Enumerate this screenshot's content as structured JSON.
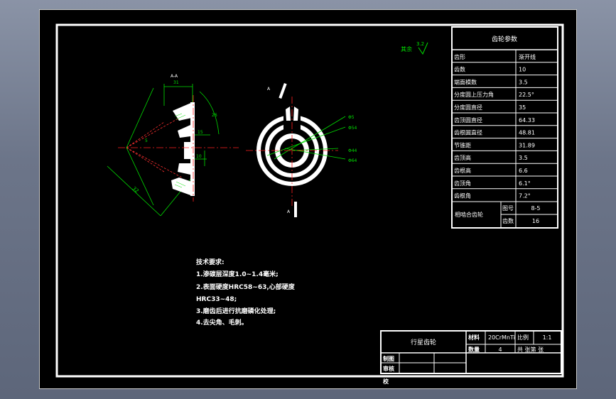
{
  "params_table": {
    "title": "齿轮参数",
    "rows": [
      {
        "label": "齿形",
        "value": "渐开线"
      },
      {
        "label": "齿数",
        "value": "10"
      },
      {
        "label": "端面模数",
        "value": "3.5"
      },
      {
        "label": "分度圆上压力角",
        "value": "22.5°"
      },
      {
        "label": "分度圆直径",
        "value": "35"
      },
      {
        "label": "齿顶圆直径",
        "value": "64.33"
      },
      {
        "label": "齿根圆直径",
        "value": "48.81"
      },
      {
        "label": "节锥距",
        "value": "31.89"
      },
      {
        "label": "齿顶高",
        "value": "3.5"
      },
      {
        "label": "齿根高",
        "value": "6.6"
      },
      {
        "label": "齿顶角",
        "value": "6.1°"
      },
      {
        "label": "齿根角",
        "value": "7.2°"
      }
    ],
    "mating": {
      "label": "相啮合齿轮",
      "sub1_label": "图号",
      "sub1_value": "8-5",
      "sub2_label": "齿数",
      "sub2_value": "16"
    }
  },
  "tech_req": {
    "title": "技术要求:",
    "lines": [
      "1.渗碳层深度1.0~1.4毫米;",
      "2.表面硬度HRC58~63,心部硬度",
      "HRC33~48;",
      "3.磨齿后进行抗磨磷化处理;",
      "4.去尖角、毛刺。"
    ]
  },
  "surface_note": {
    "text": "其余",
    "value": "3.2"
  },
  "section_label": "A-A",
  "cut_labels": {
    "top": "A",
    "bottom": "A"
  },
  "left_view": {
    "dims": [
      "31",
      "15",
      "10",
      "32",
      "5",
      "26"
    ]
  },
  "right_view": {
    "dims": [
      "Φ5",
      "Φ54",
      "Φ44",
      "Φ64"
    ]
  },
  "title_block": {
    "part_name": "行星齿轮",
    "material_label": "材料",
    "material": "20CrMnTi",
    "scale_label": "比例",
    "scale": "1:1",
    "qty_label": "数量",
    "qty": "4",
    "sheets": "共 张第 张",
    "drawn_label": "制图",
    "check_label": "审核",
    "approve_label": "校"
  },
  "colors": {
    "background": "#000000",
    "lines": "#ffffff",
    "dimension": "#00e000",
    "center": "#ff0000",
    "section": "#ff0000"
  }
}
